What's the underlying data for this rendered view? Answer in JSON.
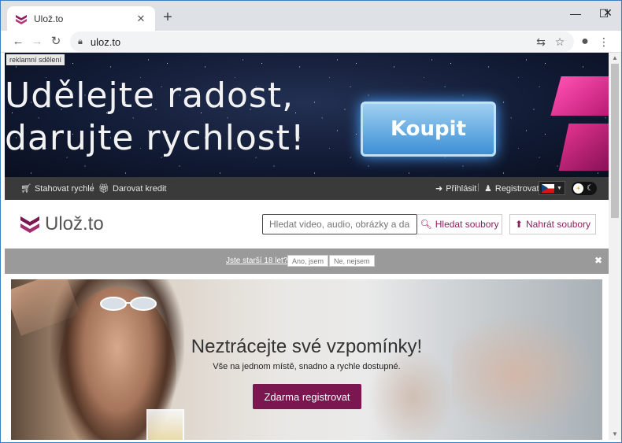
{
  "browser": {
    "tab_title": "Ulož.to",
    "tab_close": "✕",
    "new_tab": "+",
    "win_minimize": "—",
    "win_maximize": "☐",
    "win_close": "✕",
    "url": "uloz.to"
  },
  "ad": {
    "label": "reklamní sdělení",
    "headline_line1": "Udělejte radost,",
    "headline_line2": "darujte rychlost!",
    "cta": "Koupit"
  },
  "topnav": {
    "download_fast": "Stahovat rychle",
    "sep": "|",
    "gift_credit": "Darovat kredit",
    "login": "Přihlásit",
    "register": "Registrovat"
  },
  "header": {
    "logo_text": "Ulož.to",
    "search_placeholder": "Hledat video, audio, obrázky a další",
    "search_button": "Hledat soubory",
    "upload_button": "Nahrát soubory"
  },
  "agebar": {
    "question": "Jste starší 18 let?",
    "yes": "Ano, jsem",
    "no": "Ne, nejsem",
    "close": "✖"
  },
  "hero": {
    "title": "Neztrácejte své vzpomínky!",
    "subtitle": "Vše na jednom místě, snadno a rychle dostupné.",
    "button": "Zdarma registrovat"
  },
  "colors": {
    "brand": "#7a1650",
    "link": "#8e1f5d"
  }
}
